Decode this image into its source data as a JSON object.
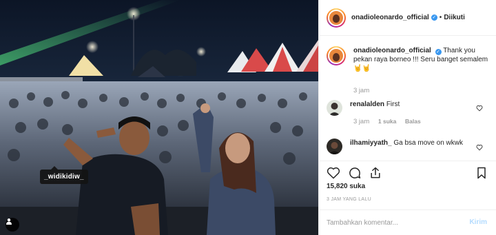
{
  "post": {
    "photo_tag": "_widikidiw_",
    "photo_alt": "Concert crowd selfie"
  },
  "header": {
    "username": "onadioleonardo_official",
    "follow_status": "Diikuti",
    "separator": "•"
  },
  "caption": {
    "username": "onadioleonardo_official",
    "text": "Thank you pekan raya borneo !!! Seru banget semalem 🤘🤘",
    "time": "3 jam"
  },
  "comments": [
    {
      "username": "renalalden",
      "text": "First",
      "time": "3 jam",
      "likes": "1 suka",
      "reply": "Balas"
    },
    {
      "username": "ilhamiyyath_",
      "text": "Ga bsa move on wkwk"
    }
  ],
  "actions": {
    "likes": "15,820 suka",
    "timestamp": "3 JAM YANG LALU"
  },
  "add_comment": {
    "placeholder": "Tambahkan komentar...",
    "submit": "Kirim"
  },
  "colors": {
    "link_blue": "#3897f0",
    "muted": "#999999",
    "post_disabled": "#b3dbff"
  }
}
